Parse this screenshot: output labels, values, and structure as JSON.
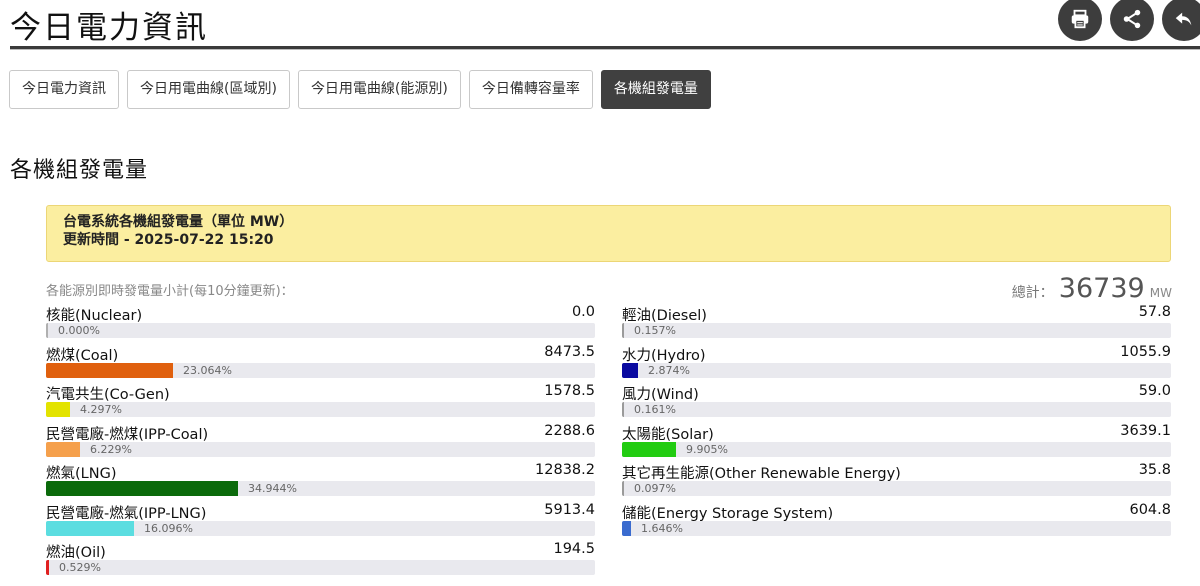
{
  "header": {
    "title": "今日電力資訊",
    "buttons": [
      {
        "name": "print-button",
        "icon": "printer-icon"
      },
      {
        "name": "share-button",
        "icon": "share-icon"
      },
      {
        "name": "back-button",
        "icon": "back-arrow-icon"
      }
    ]
  },
  "tabs": [
    {
      "label": "今日電力資訊",
      "active": false
    },
    {
      "label": "今日用電曲線(區域別)",
      "active": false
    },
    {
      "label": "今日用電曲線(能源別)",
      "active": false
    },
    {
      "label": "今日備轉容量率",
      "active": false
    },
    {
      "label": "各機組發電量",
      "active": true
    }
  ],
  "section_title": "各機組發電量",
  "notice": {
    "line1": "台電系統各機組發電量（單位 MW）",
    "line2": "更新時間 - 2025-07-22 15:20"
  },
  "subtitle": "各能源別即時發電量小計(每10分鐘更新)：",
  "total": {
    "label": "總計：",
    "value": "36739",
    "unit": "MW"
  },
  "sources_left": [
    {
      "name": "核能(Nuclear)",
      "value": "0.0",
      "pct": "0.000%",
      "fraction": 0.0,
      "color": "#b0b0b0"
    },
    {
      "name": "燃煤(Coal)",
      "value": "8473.5",
      "pct": "23.064%",
      "fraction": 0.23064,
      "color": "#e0600e"
    },
    {
      "name": "汽電共生(Co-Gen)",
      "value": "1578.5",
      "pct": "4.297%",
      "fraction": 0.04297,
      "color": "#e3e300"
    },
    {
      "name": "民營電廠-燃煤(IPP-Coal)",
      "value": "2288.6",
      "pct": "6.229%",
      "fraction": 0.06229,
      "color": "#f5a04c"
    },
    {
      "name": "燃氣(LNG)",
      "value": "12838.2",
      "pct": "34.944%",
      "fraction": 0.34944,
      "color": "#0b6a0b"
    },
    {
      "name": "民營電廠-燃氣(IPP-LNG)",
      "value": "5913.4",
      "pct": "16.096%",
      "fraction": 0.16096,
      "color": "#5bdde0"
    },
    {
      "name": "燃油(Oil)",
      "value": "194.5",
      "pct": "0.529%",
      "fraction": 0.00529,
      "color": "#e02020"
    }
  ],
  "sources_right": [
    {
      "name": "輕油(Diesel)",
      "value": "57.8",
      "pct": "0.157%",
      "fraction": 0.00157,
      "color": "#9a9a9a"
    },
    {
      "name": "水力(Hydro)",
      "value": "1055.9",
      "pct": "2.874%",
      "fraction": 0.02874,
      "color": "#0a0aa0"
    },
    {
      "name": "風力(Wind)",
      "value": "59.0",
      "pct": "0.161%",
      "fraction": 0.00161,
      "color": "#9a9a9a"
    },
    {
      "name": "太陽能(Solar)",
      "value": "3639.1",
      "pct": "9.905%",
      "fraction": 0.09905,
      "color": "#22cc11"
    },
    {
      "name": "其它再生能源(Other Renewable Energy)",
      "value": "35.8",
      "pct": "0.097%",
      "fraction": 0.00097,
      "color": "#9a9a9a"
    },
    {
      "name": "儲能(Energy Storage System)",
      "value": "604.8",
      "pct": "1.646%",
      "fraction": 0.01646,
      "color": "#3a6bcf"
    }
  ]
}
